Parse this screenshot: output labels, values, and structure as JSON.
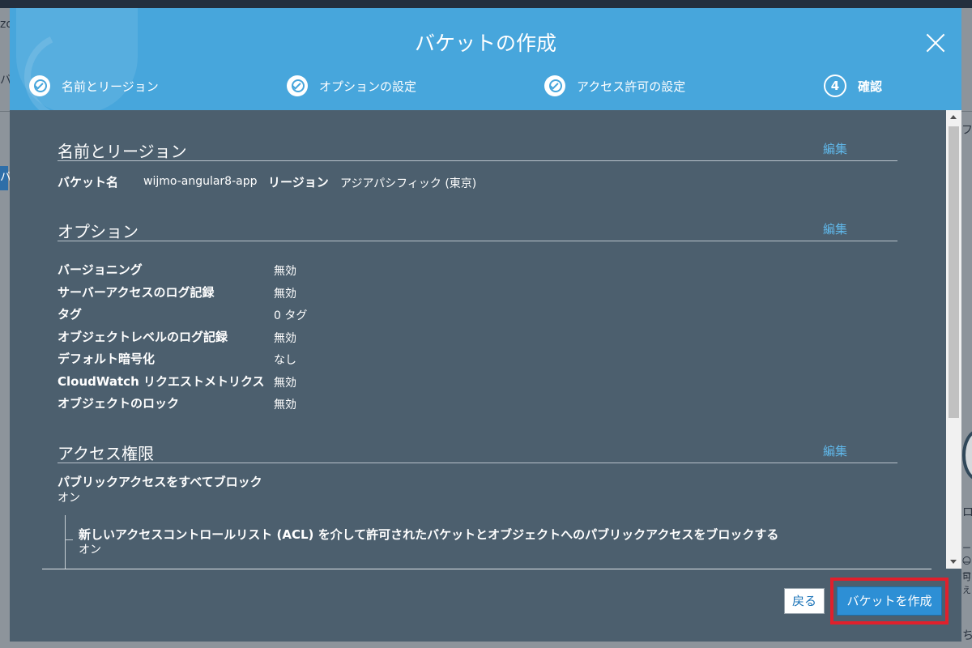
{
  "background": {
    "fragments": [
      "zo",
      "バ",
      "フ",
      "バ",
      "ロ",
      "ー〇",
      "ーロ",
      "可え",
      "ち"
    ]
  },
  "modal": {
    "title": "バケットの作成",
    "steps": [
      {
        "label": "名前とリージョン"
      },
      {
        "label": "オプションの設定"
      },
      {
        "label": "アクセス許可の設定"
      },
      {
        "number": "4",
        "label": "確認"
      }
    ],
    "sections": {
      "name_region": {
        "title": "名前とリージョン",
        "edit": "編集",
        "bucket_label": "バケット名",
        "bucket_value": "wijmo-angular8-app",
        "region_label": "リージョン",
        "region_value": "アジアパシフィック (東京)"
      },
      "options": {
        "title": "オプション",
        "edit": "編集",
        "rows": [
          {
            "label": "バージョニング",
            "value": "無効"
          },
          {
            "label": "サーバーアクセスのログ記録",
            "value": "無効"
          },
          {
            "label": "タグ",
            "value": "0 タグ"
          },
          {
            "label": "オブジェクトレベルのログ記録",
            "value": "無効"
          },
          {
            "label": "デフォルト暗号化",
            "value": "なし"
          },
          {
            "label": "CloudWatch リクエストメトリクス",
            "value": "無効"
          },
          {
            "label": "オブジェクトのロック",
            "value": "無効"
          }
        ]
      },
      "access": {
        "title": "アクセス権限",
        "edit": "編集",
        "block_all_label": "パブリックアクセスをすべてブロック",
        "block_all_value": "オン",
        "acl_label": "新しいアクセスコントロールリスト (ACL) を介して許可されたバケットとオブジェクトへのパブリックアクセスをブロックする",
        "acl_value": "オン"
      }
    },
    "buttons": {
      "back": "戻る",
      "create": "バケットを作成"
    }
  }
}
